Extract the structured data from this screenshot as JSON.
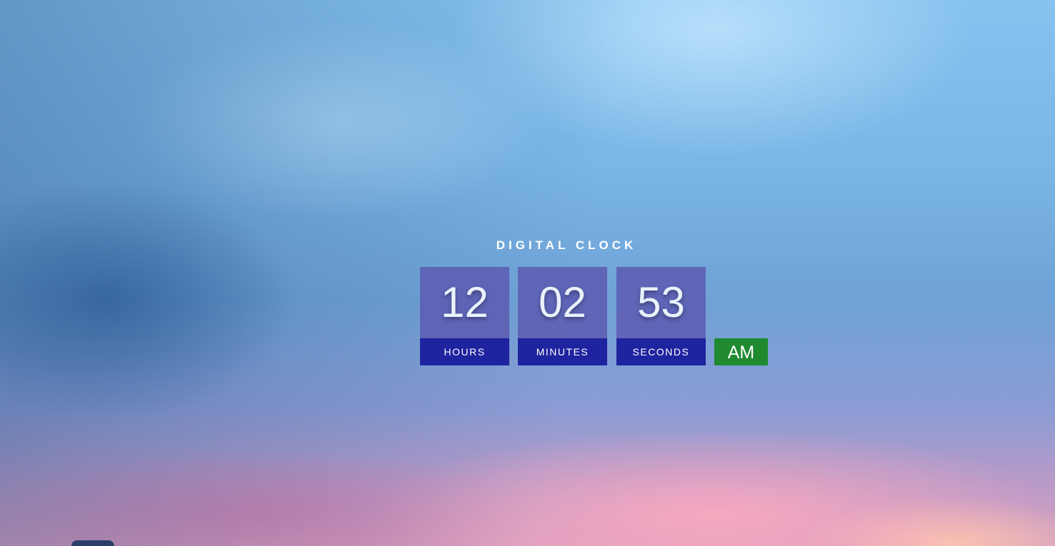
{
  "clock": {
    "title": "DIGITAL CLOCK",
    "hours": {
      "value": "12",
      "label": "HOURS"
    },
    "minutes": {
      "value": "02",
      "label": "MINUTES"
    },
    "seconds": {
      "value": "53",
      "label": "SECONDS"
    },
    "period": "AM"
  },
  "colors": {
    "digit_box": "#5c58b0",
    "label_bar": "#1e239f",
    "period_badge": "#1f8a30",
    "text": "#ffffff"
  }
}
